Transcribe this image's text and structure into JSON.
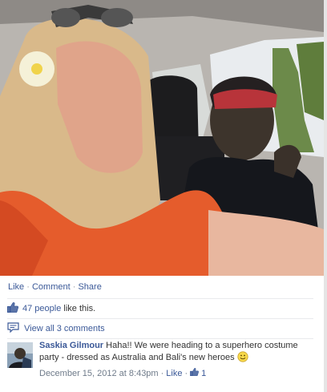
{
  "photo": {
    "alt_icon": "photo"
  },
  "actions": {
    "like": "Like",
    "comment": "Comment",
    "share": "Share",
    "sep": "·"
  },
  "likes": {
    "count_link": "47 people",
    "suffix": "like this.",
    "icon": "thumbs-up-icon"
  },
  "comments": {
    "view_all": "View all 3 comments",
    "icon": "comment-icon"
  },
  "comment": {
    "author": "Saskia Gilmour",
    "text": "Haha!! We were heading to a superhero costume party - dressed as Australia and Bali's new heroes",
    "timestamp": "December 15, 2012 at 8:43pm",
    "like": "Like",
    "like_count": "1",
    "sep": "·"
  },
  "colors": {
    "link": "#3b5998",
    "meta": "#6f7b8a"
  }
}
